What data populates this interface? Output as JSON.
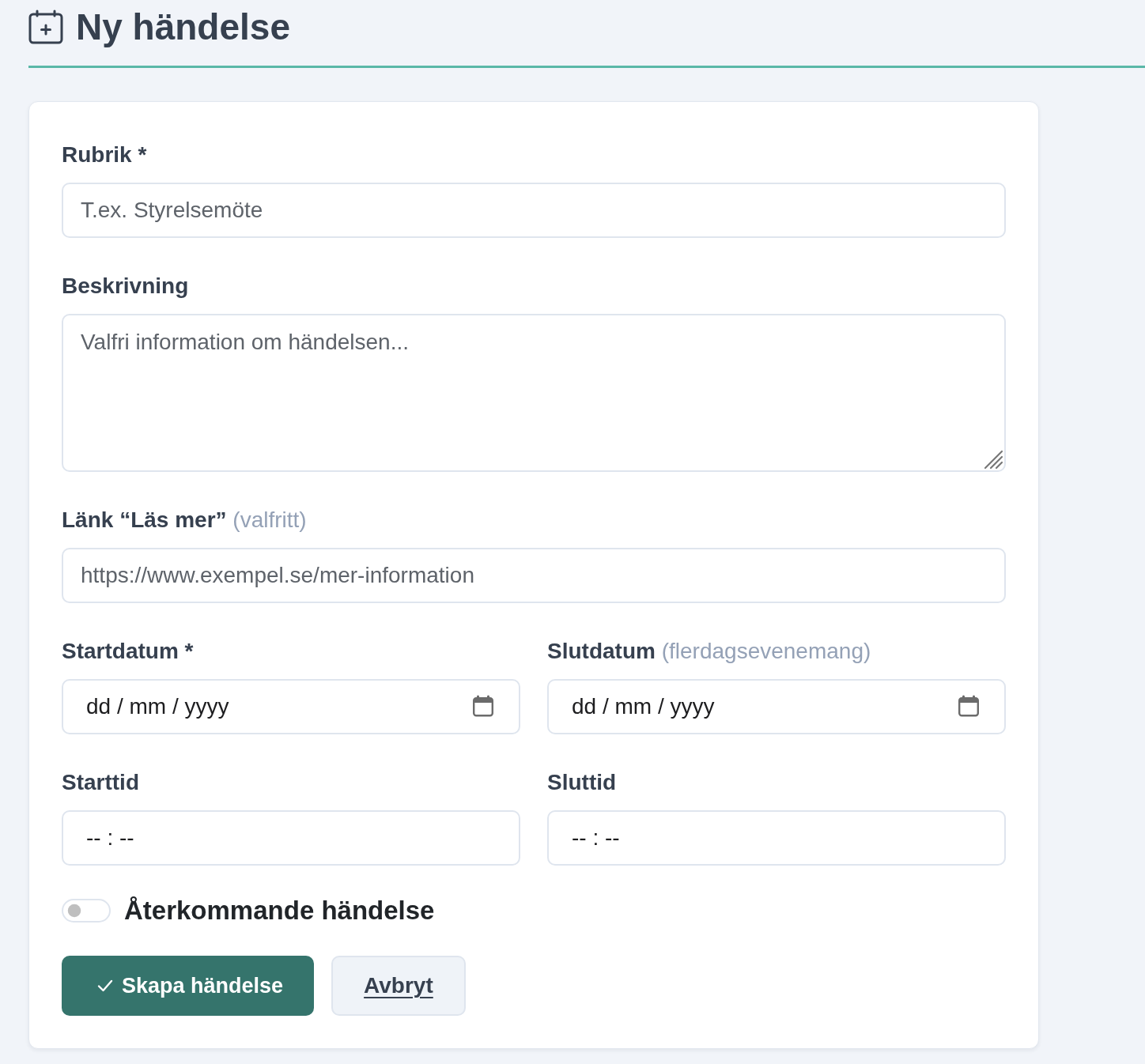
{
  "page": {
    "title": "Ny händelse"
  },
  "form": {
    "rows": [
      {
        "fields": [
          {
            "kind": "text",
            "label": "Rubrik *",
            "placeholder": "T.ex. Styrelsemöte"
          }
        ]
      },
      {
        "fields": [
          {
            "kind": "textarea",
            "label": "Beskrivning",
            "placeholder": "Valfri information om händelsen..."
          }
        ]
      },
      {
        "fields": [
          {
            "kind": "url",
            "label": "Länk “Läs mer”",
            "note": "(valfritt)",
            "placeholder": "https://www.exempel.se/mer-information"
          }
        ]
      },
      {
        "fields": [
          {
            "kind": "date",
            "label": "Startdatum *",
            "placeholder": "dd / mm / yyyy"
          },
          {
            "kind": "date",
            "label": "Slutdatum",
            "note": "(flerdagsevenemang)",
            "placeholder": "dd / mm / yyyy"
          }
        ]
      },
      {
        "fields": [
          {
            "kind": "time",
            "label": "Starttid",
            "placeholder": "-- : --"
          },
          {
            "kind": "time",
            "label": "Sluttid",
            "placeholder": "-- : --"
          }
        ]
      }
    ],
    "toggle": {
      "label": "Återkommande händelse",
      "on": false
    },
    "buttons": [
      {
        "kind": "primary",
        "label": "Skapa händelse"
      },
      {
        "kind": "secondary",
        "label": "Avbryt"
      }
    ]
  }
}
